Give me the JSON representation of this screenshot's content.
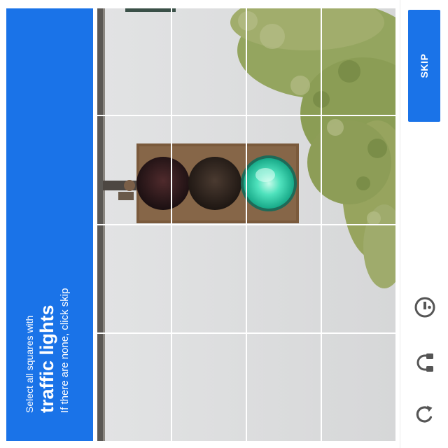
{
  "instructions": {
    "line1": "Select all squares with",
    "target": "traffic lights",
    "line3": "If there are none, click skip"
  },
  "grid": {
    "rows": 4,
    "cols": 4,
    "image_subject": "traffic light"
  },
  "toolbar": {
    "skip_label": "SKIP",
    "icons": [
      "info-icon",
      "headphones-icon",
      "refresh-icon"
    ]
  },
  "colors": {
    "accent": "#1a73e8",
    "instruction_bg": "#1a73e8",
    "skip_bg": "#1a73e8",
    "icon_color": "#555555",
    "green_light": "#34d6b0"
  }
}
